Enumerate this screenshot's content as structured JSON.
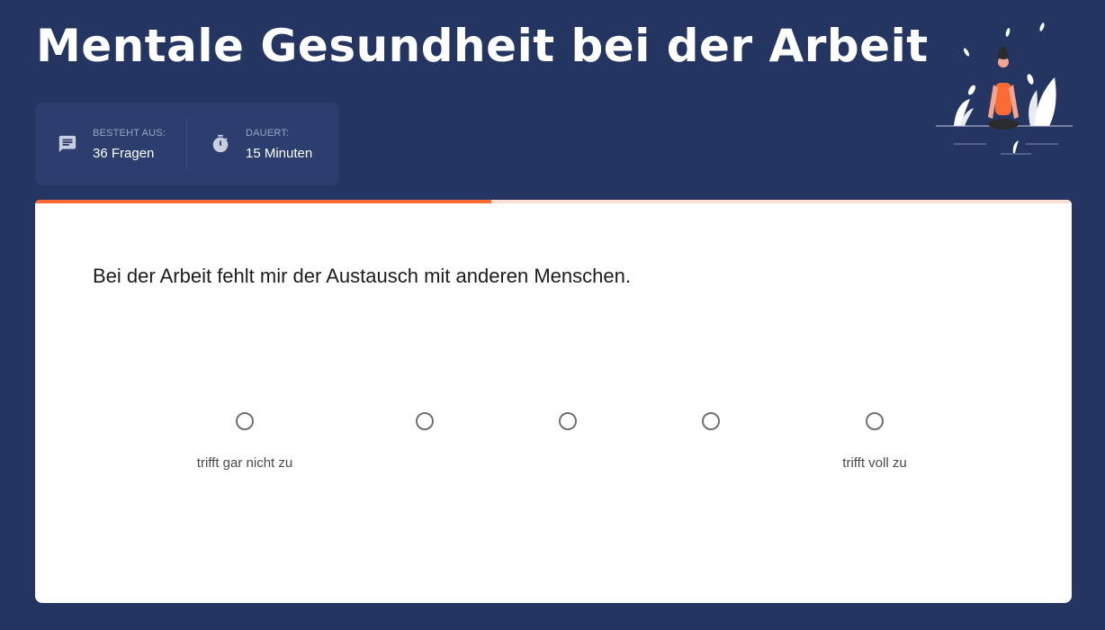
{
  "header": {
    "title": "Mentale Gesundheit bei der Arbeit"
  },
  "info": {
    "questions": {
      "label": "BESTEHT AUS:",
      "value": "36 Fragen",
      "icon": "chat-icon"
    },
    "duration": {
      "label": "DAUERT:",
      "value": "15 Minuten",
      "icon": "stopwatch-icon"
    }
  },
  "progress": {
    "fraction": 0.44
  },
  "question": {
    "text": "Bei der Arbeit fehlt mir der Austausch mit anderen Menschen.",
    "options_count": 5,
    "min_label": "trifft gar nicht zu",
    "max_label": "trifft voll zu"
  },
  "colors": {
    "background": "#243562",
    "accent": "#fc6b33",
    "progress_track": "#fde0d3"
  }
}
